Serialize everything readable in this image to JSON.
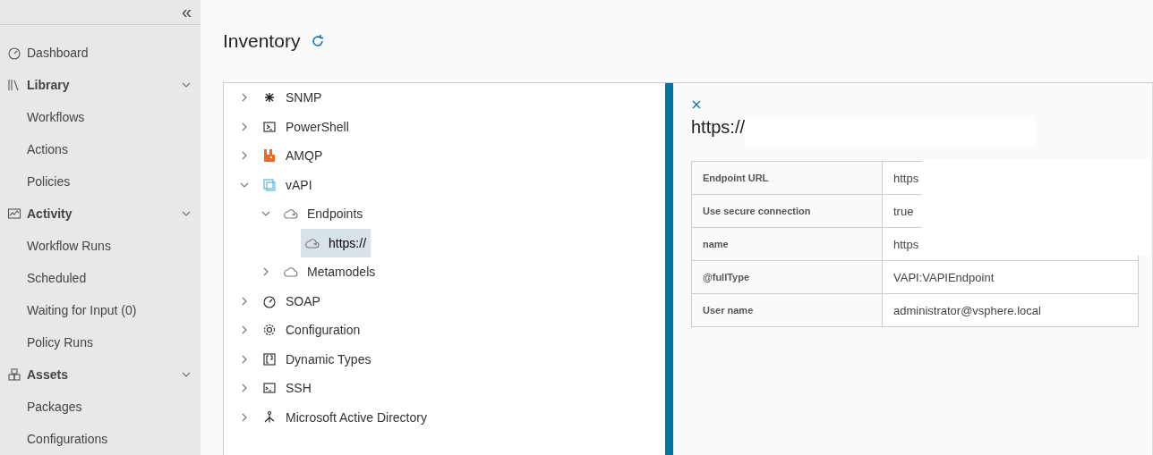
{
  "sidebar": {
    "collapse_glyph": "«",
    "items": [
      {
        "label": "Dashboard",
        "kind": "link"
      },
      {
        "label": "Library",
        "kind": "group",
        "expanded": true,
        "children": [
          {
            "label": "Workflows"
          },
          {
            "label": "Actions"
          },
          {
            "label": "Policies"
          }
        ]
      },
      {
        "label": "Activity",
        "kind": "group",
        "expanded": true,
        "children": [
          {
            "label": "Workflow Runs"
          },
          {
            "label": "Scheduled"
          },
          {
            "label": "Waiting for Input (0)"
          },
          {
            "label": "Policy Runs"
          }
        ]
      },
      {
        "label": "Assets",
        "kind": "group",
        "expanded": true,
        "children": [
          {
            "label": "Packages"
          },
          {
            "label": "Configurations"
          }
        ]
      }
    ]
  },
  "page": {
    "title": "Inventory"
  },
  "tree": [
    {
      "label": "SNMP",
      "expanded": false,
      "selected": false
    },
    {
      "label": "PowerShell",
      "expanded": false,
      "selected": false
    },
    {
      "label": "AMQP",
      "expanded": false,
      "selected": false
    },
    {
      "label": "vAPI",
      "expanded": true,
      "selected": false,
      "children": [
        {
          "label": "Endpoints",
          "expanded": true,
          "selected": false,
          "children": [
            {
              "label": "https://",
              "selected": true
            }
          ]
        },
        {
          "label": "Metamodels",
          "expanded": false,
          "selected": false
        }
      ]
    },
    {
      "label": "SOAP",
      "expanded": false,
      "selected": false
    },
    {
      "label": "Configuration",
      "expanded": false,
      "selected": false
    },
    {
      "label": "Dynamic Types",
      "expanded": false,
      "selected": false
    },
    {
      "label": "SSH",
      "expanded": false,
      "selected": false
    },
    {
      "label": "Microsoft Active Directory",
      "expanded": false,
      "selected": false
    }
  ],
  "details": {
    "title": "https://",
    "properties": [
      {
        "name": "Endpoint URL",
        "value": "https"
      },
      {
        "name": "Use secure connection",
        "value": "true"
      },
      {
        "name": "name",
        "value": "https"
      },
      {
        "name": "@fullType",
        "value": "VAPI:VAPIEndpoint"
      },
      {
        "name": "User name",
        "value": "administrator@vsphere.local"
      }
    ]
  }
}
